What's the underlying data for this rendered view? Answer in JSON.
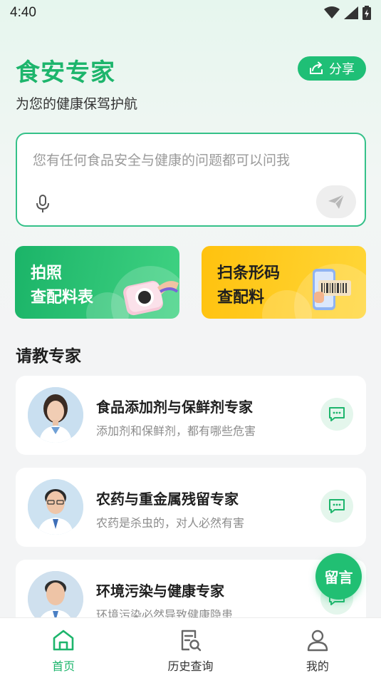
{
  "status_bar": {
    "time": "4:40"
  },
  "header": {
    "title": "食安专家",
    "subtitle": "为您的健康保驾护航",
    "share_label": "分享"
  },
  "ask": {
    "placeholder": "您有任何食品安全与健康的问题都可以问我"
  },
  "feature_cards": [
    {
      "line1": "拍照",
      "line2": "查配料表"
    },
    {
      "line1": "扫条形码",
      "line2": "查配料"
    }
  ],
  "experts_section": {
    "title": "请教专家",
    "items": [
      {
        "name": "食品添加剂与保鲜剂专家",
        "desc": "添加剂和保鲜剂，都有哪些危害"
      },
      {
        "name": "农药与重金属残留专家",
        "desc": "农药是杀虫的，对人必然有害"
      },
      {
        "name": "环境污染与健康专家",
        "desc": "环境污染必然导致健康隐患"
      }
    ]
  },
  "fab": {
    "label": "留言"
  },
  "tabbar": {
    "tabs": [
      {
        "label": "首页",
        "icon": "home-icon"
      },
      {
        "label": "历史查询",
        "icon": "history-search-icon"
      },
      {
        "label": "我的",
        "icon": "user-icon"
      }
    ]
  },
  "colors": {
    "accent": "#1db56c",
    "photo_card": "#1bb468",
    "scan_card": "#ffc20e"
  }
}
